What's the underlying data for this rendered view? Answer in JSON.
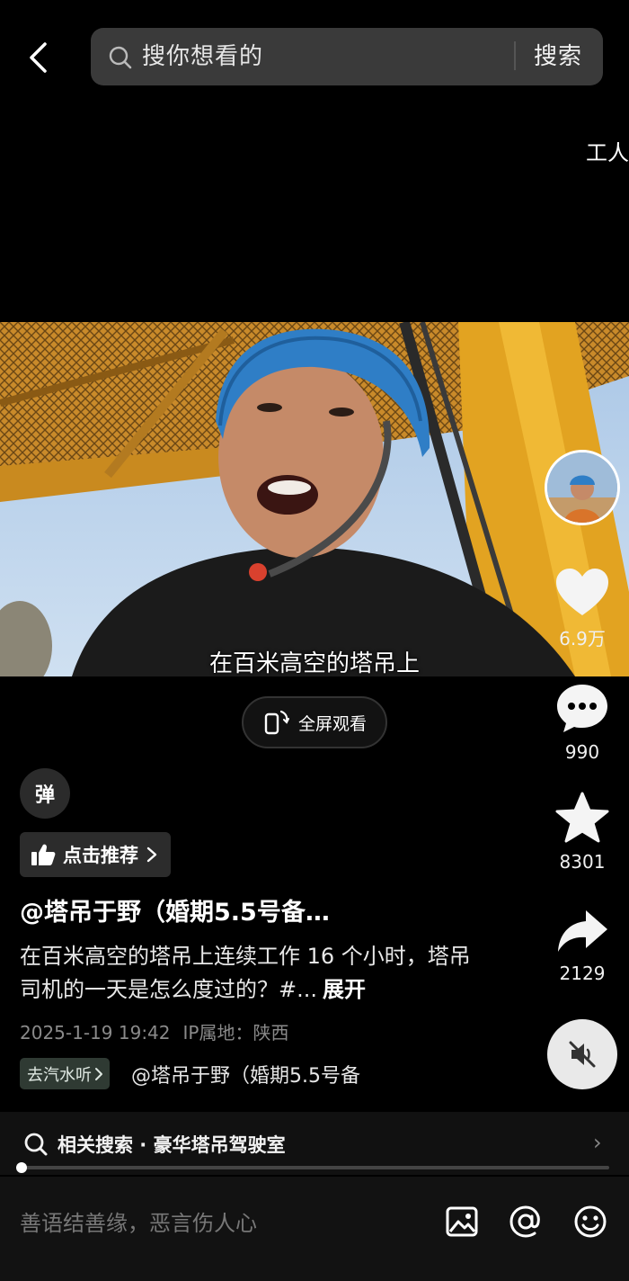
{
  "header": {
    "search_placeholder": "搜你想看的",
    "search_button": "搜索",
    "side_tab_label": "工人"
  },
  "video": {
    "caption": "在百米高空的塔吊上",
    "fullscreen_label": "全屏观看"
  },
  "actions": {
    "likes": "6.9万",
    "comments": "990",
    "favorites": "8301",
    "shares": "2129"
  },
  "post": {
    "danmaku_label": "弹",
    "recommend_label": "点击推荐",
    "author": "@塔吊于野（婚期5.5号备…",
    "description": "在百米高空的塔吊上连续工作 16 个小时，塔吊司机的一天是怎么度过的？#...",
    "expand_label": "展开",
    "date": "2025-1-19 19:42",
    "ip_location": "IP属地：陕西",
    "music_chip": "去汽水听",
    "music_text": "@塔吊于野（婚期5.5号备"
  },
  "related_search": {
    "text": "相关搜索 · 豪华塔吊驾驶室"
  },
  "playback": {
    "progress_fraction": 0.002
  },
  "comment_bar": {
    "placeholder": "善语结善缘，恶言伤人心"
  },
  "icons": {
    "back": "back-arrow-icon",
    "search": "search-icon",
    "like": "heart-icon",
    "comment": "comment-bubble-icon",
    "favorite": "star-icon",
    "share": "share-arrow-icon",
    "mute": "muted-speaker-icon",
    "fullscreen": "rotate-phone-icon",
    "recommend": "thumbs-up-icon",
    "image": "image-icon",
    "at": "at-icon",
    "emoji": "emoji-icon"
  },
  "colors": {
    "background": "#000000",
    "search_bar": "#3a3a3a",
    "meta_text": "#8a8a8a",
    "music_chip": "#2f3a33"
  }
}
